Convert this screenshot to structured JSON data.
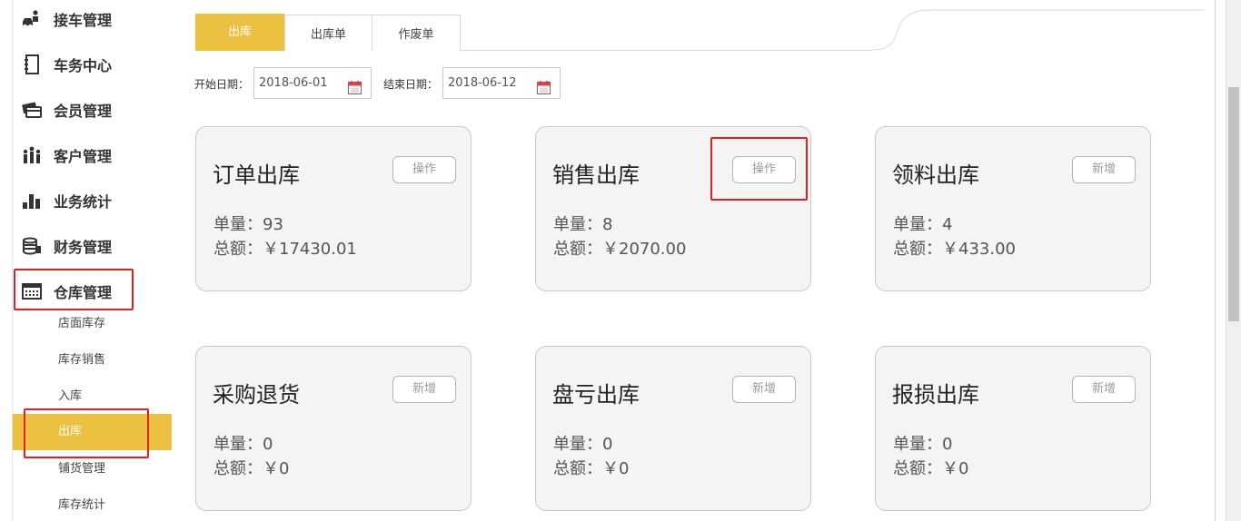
{
  "sidebar": {
    "items": [
      {
        "label": "接车管理",
        "icon": "car-person-icon"
      },
      {
        "label": "车务中心",
        "icon": "notebook-icon"
      },
      {
        "label": "会员管理",
        "icon": "member-card-icon"
      },
      {
        "label": "客户管理",
        "icon": "people-group-icon"
      },
      {
        "label": "业务统计",
        "icon": "bar-chart-icon"
      },
      {
        "label": "财务管理",
        "icon": "coin-stack-icon"
      },
      {
        "label": "仓库管理",
        "icon": "warehouse-icon"
      }
    ],
    "subitems": [
      {
        "label": "店面库存"
      },
      {
        "label": "库存销售"
      },
      {
        "label": "入库"
      },
      {
        "label": "出库",
        "active": true
      },
      {
        "label": "铺货管理"
      },
      {
        "label": "库存统计"
      }
    ]
  },
  "tabs": [
    {
      "label": "出库",
      "active": true
    },
    {
      "label": "出库单"
    },
    {
      "label": "作废单"
    }
  ],
  "filters": {
    "start_label": "开始日期：",
    "start_value": "2018-06-01",
    "end_label": "结束日期：",
    "end_value": "2018-06-12"
  },
  "cards": [
    {
      "title": "订单出库",
      "button": "操作",
      "count": "单量：93",
      "amount": "总额：￥17430.01"
    },
    {
      "title": "销售出库",
      "button": "操作",
      "count": "单量：8",
      "amount": "总额：￥2070.00"
    },
    {
      "title": "领料出库",
      "button": "新增",
      "count": "单量：4",
      "amount": "总额：￥433.00"
    },
    {
      "title": "采购退货",
      "button": "新增",
      "count": "单量：0",
      "amount": "总额：￥0"
    },
    {
      "title": "盘亏出库",
      "button": "新增",
      "count": "单量：0",
      "amount": "总额：￥0"
    },
    {
      "title": "报损出库",
      "button": "新增",
      "count": "单量：0",
      "amount": "总额：￥0"
    }
  ],
  "colors": {
    "accent": "#ecc142",
    "highlight": "#e02020",
    "card_bg": "#f4f4f4"
  }
}
